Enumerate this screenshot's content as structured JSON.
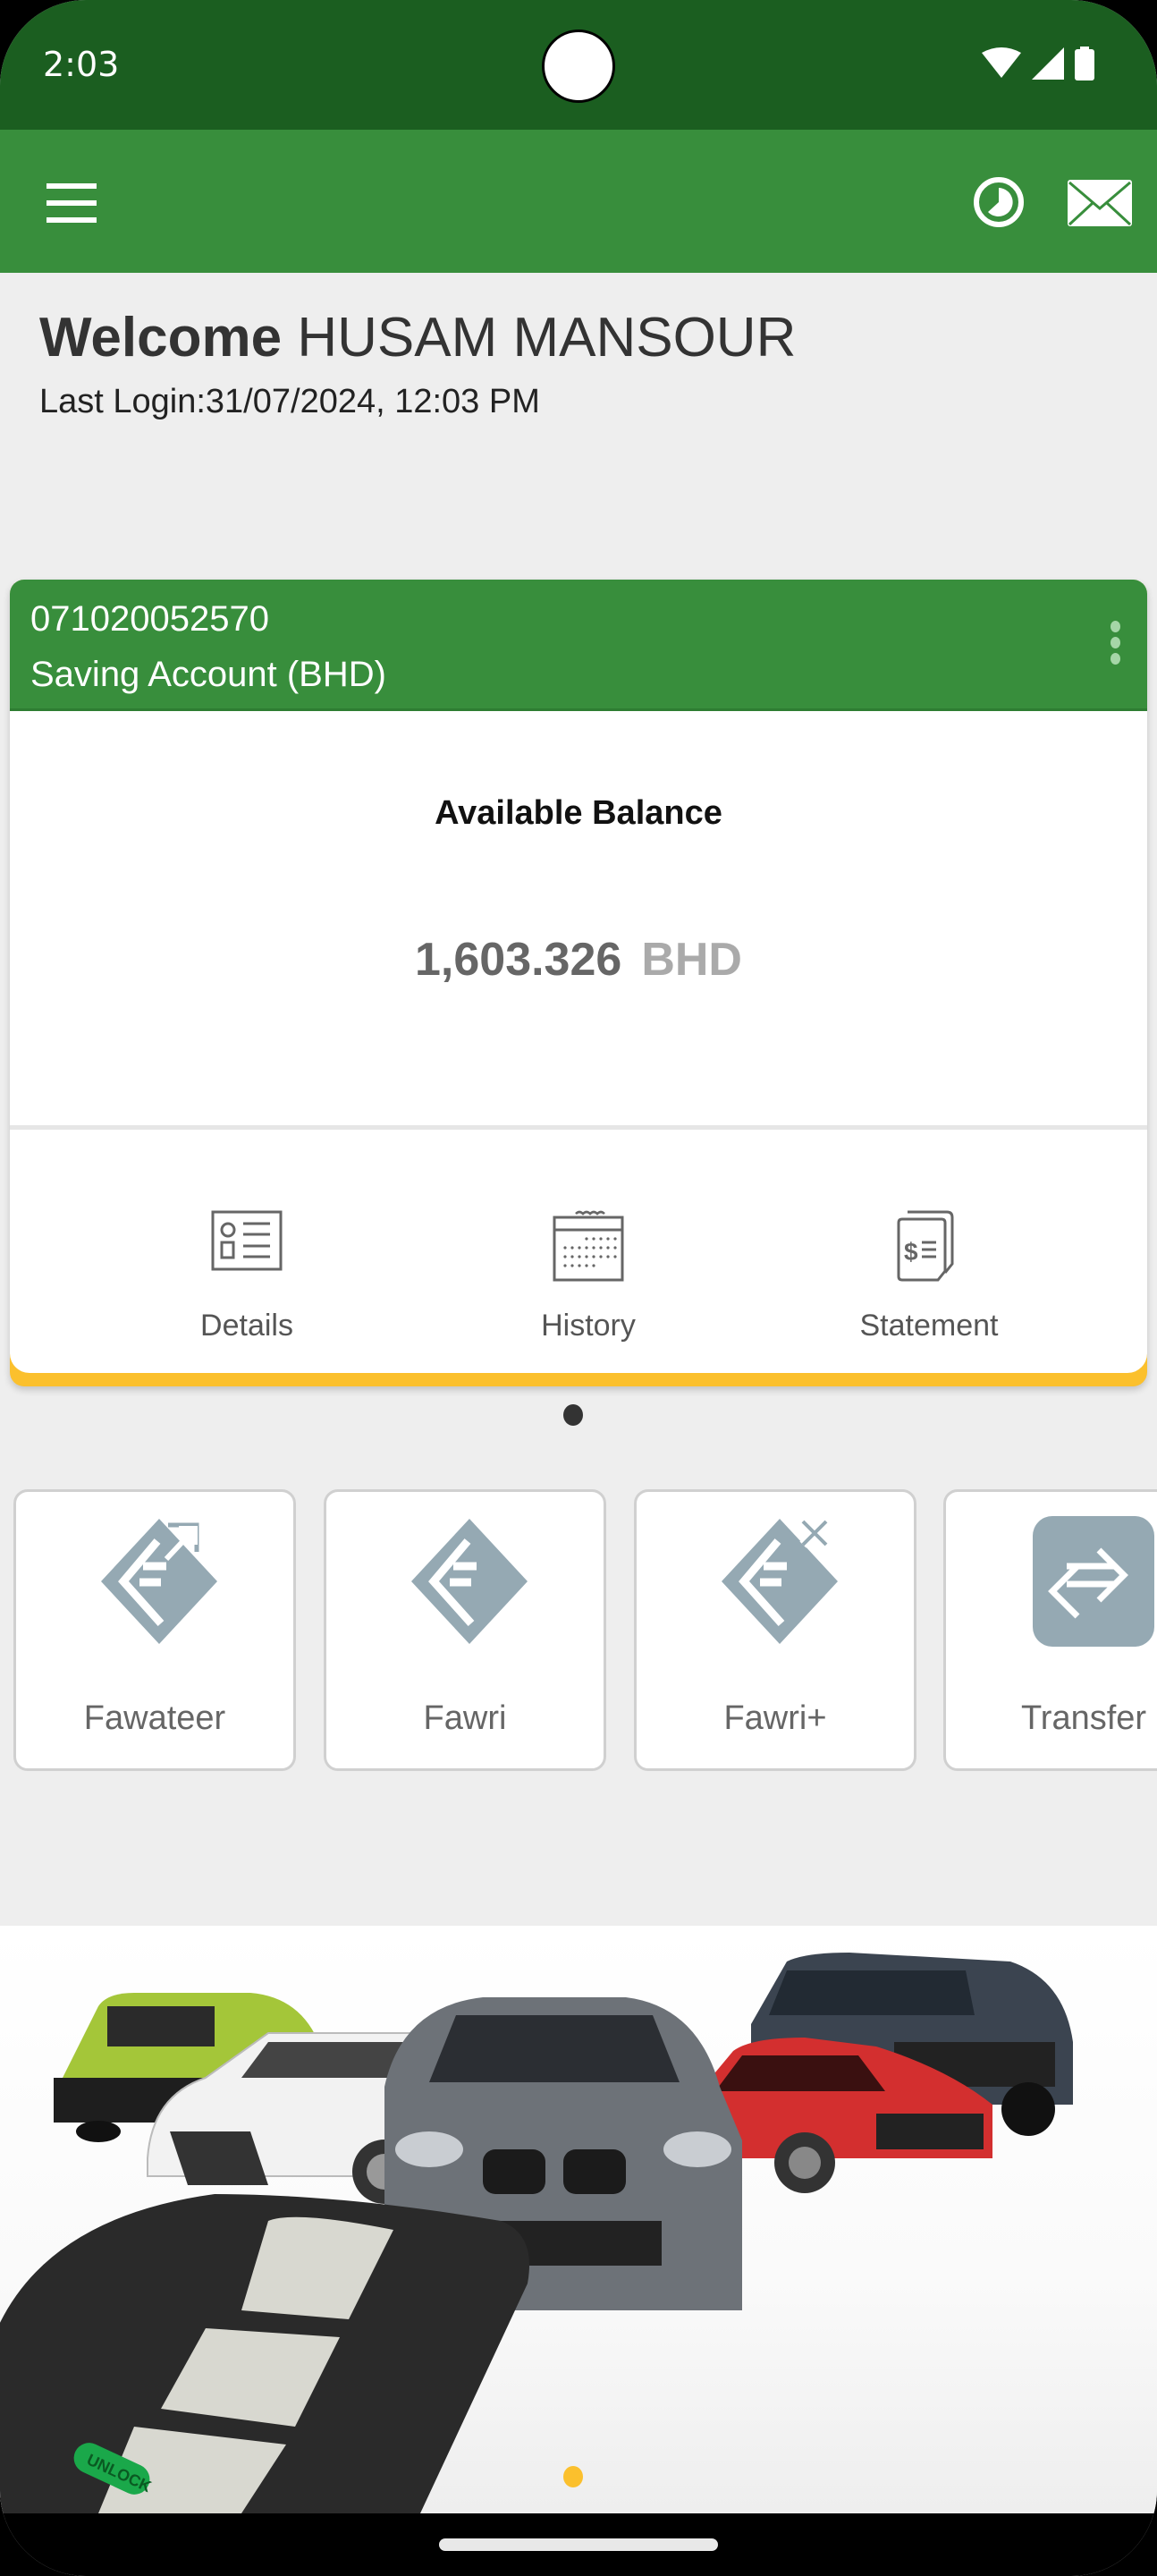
{
  "status_bar": {
    "time": "2:03",
    "icons": [
      "wifi-icon",
      "cellular-signal-icon",
      "battery-icon"
    ]
  },
  "app_bar": {
    "menu_icon": "hamburger-menu-icon",
    "actions": [
      "clock-history-icon",
      "mail-envelope-icon"
    ]
  },
  "welcome": {
    "greeting": "Welcome",
    "user_name": "HUSAM MANSOUR",
    "last_login": "Last Login:31/07/2024, 12:03 PM"
  },
  "account_card": {
    "account_number": "071020052570",
    "account_type": "Saving Account (BHD)",
    "balance_label": "Available Balance",
    "balance_amount": "1,603.326",
    "balance_currency": "BHD",
    "actions": [
      {
        "label": "Details",
        "icon": "details-card-icon"
      },
      {
        "label": "History",
        "icon": "calendar-icon"
      },
      {
        "label": "Statement",
        "icon": "statement-document-icon"
      }
    ]
  },
  "card_pager": {
    "pages": 1,
    "current": 1
  },
  "quick_services": [
    {
      "label": "Fawateer",
      "icon": "fawateer-icon"
    },
    {
      "label": "Fawri",
      "icon": "fawri-icon"
    },
    {
      "label": "Fawri+",
      "icon": "fawri-plus-icon"
    },
    {
      "label": "Transfer",
      "icon": "transfer-arrows-icon"
    }
  ],
  "banner": {
    "description": "Car loan promotional banner with cars and key fob",
    "key_button_text": "UNLOCK",
    "pages": 1,
    "current": 1
  },
  "colors": {
    "status_bar": "#1b5e20",
    "primary_green": "#388e3c",
    "accent_yellow": "#fbc02d",
    "icon_gray": "#95a9b3",
    "background": "#eeeeee"
  }
}
